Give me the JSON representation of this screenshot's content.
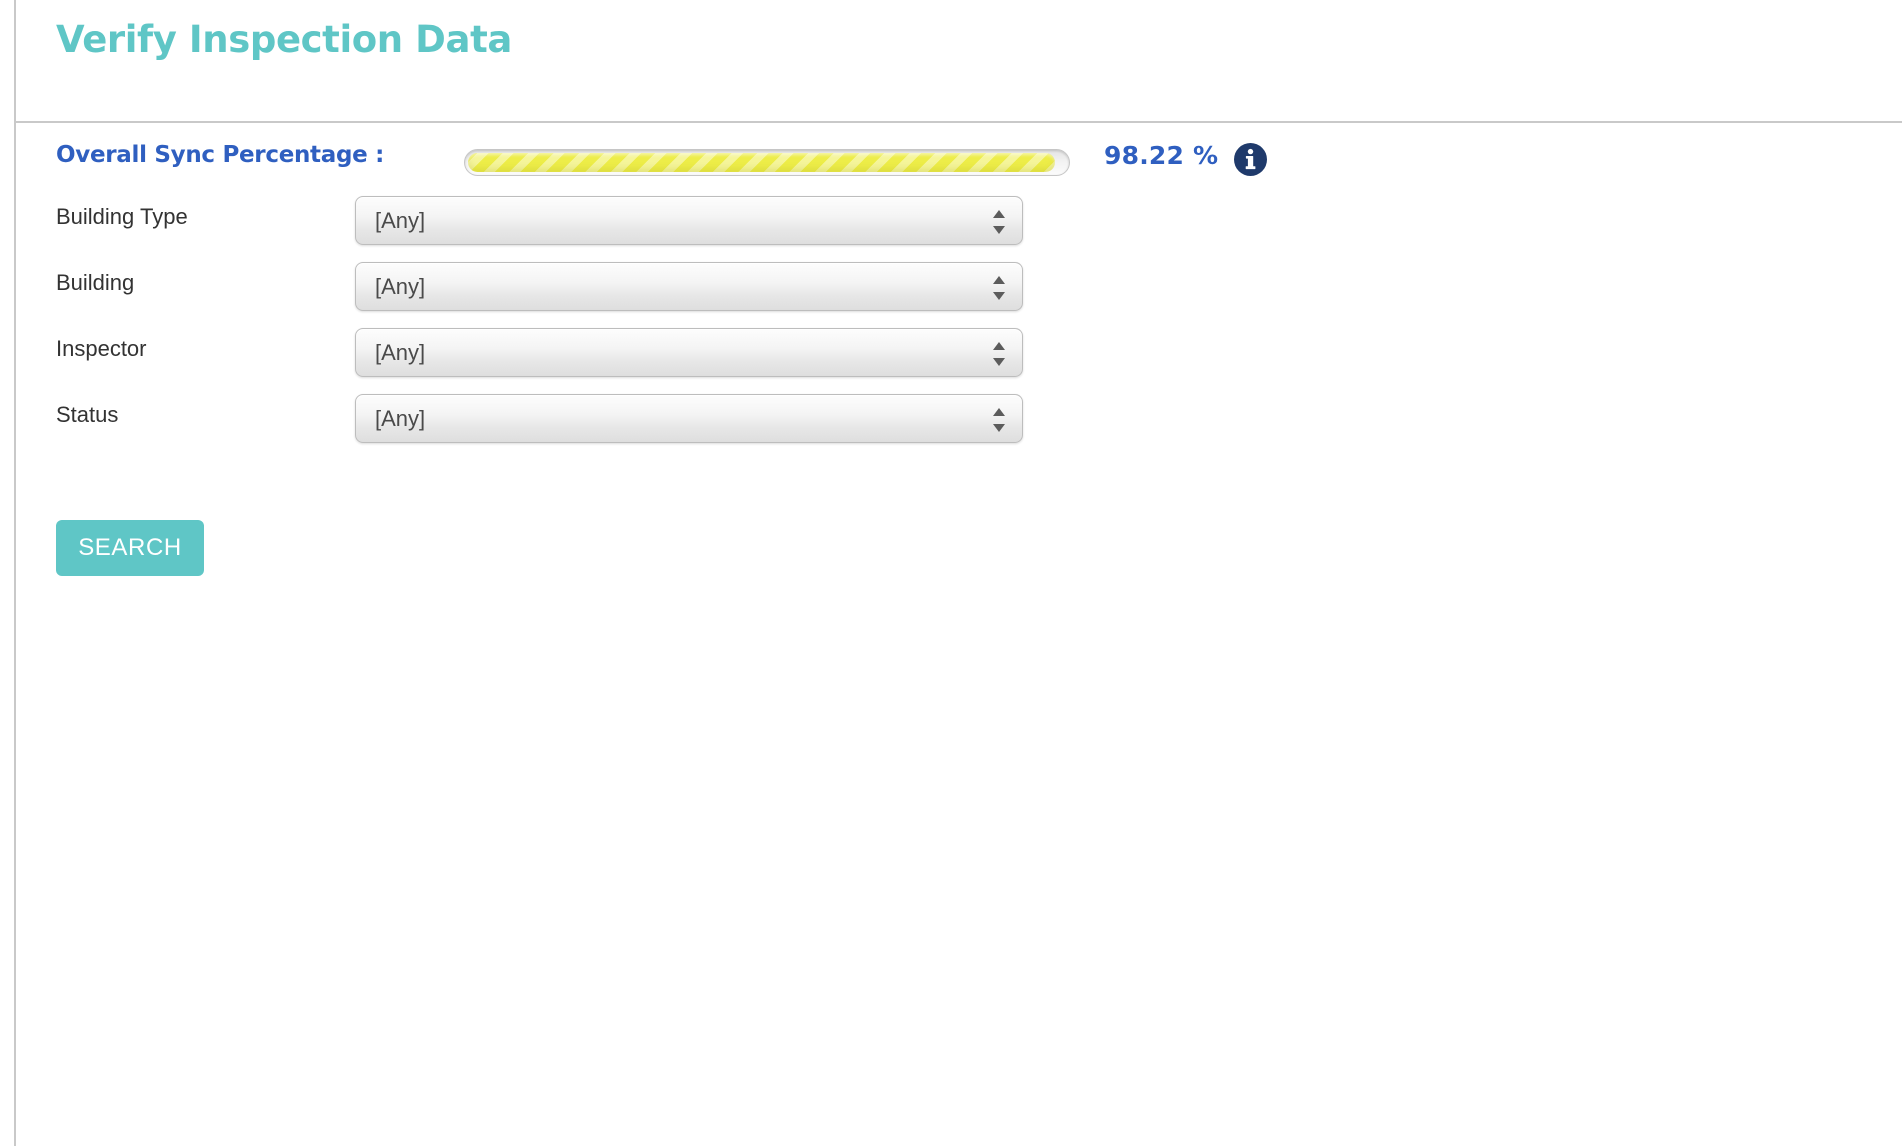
{
  "header": {
    "title": "Verify Inspection Data"
  },
  "sync": {
    "label": "Overall Sync Percentage :",
    "value_text": "98.22 %",
    "percent": 98.22,
    "bar_fill_color": "#eded48",
    "text_color": "#2f5fc0",
    "info_tooltip_icon": "info-circle-icon"
  },
  "form": {
    "fields": [
      {
        "label": "Building Type",
        "value": "[Any]"
      },
      {
        "label": "Building",
        "value": "[Any]"
      },
      {
        "label": "Inspector",
        "value": "[Any]"
      },
      {
        "label": "Status",
        "value": "[Any]"
      }
    ],
    "search_button_label": "SEARCH"
  },
  "theme": {
    "accent": "#5fc6c6",
    "link_blue": "#2f5fc0",
    "info_navy": "#1f3a6b",
    "rule_gray": "#c9c9c9"
  }
}
